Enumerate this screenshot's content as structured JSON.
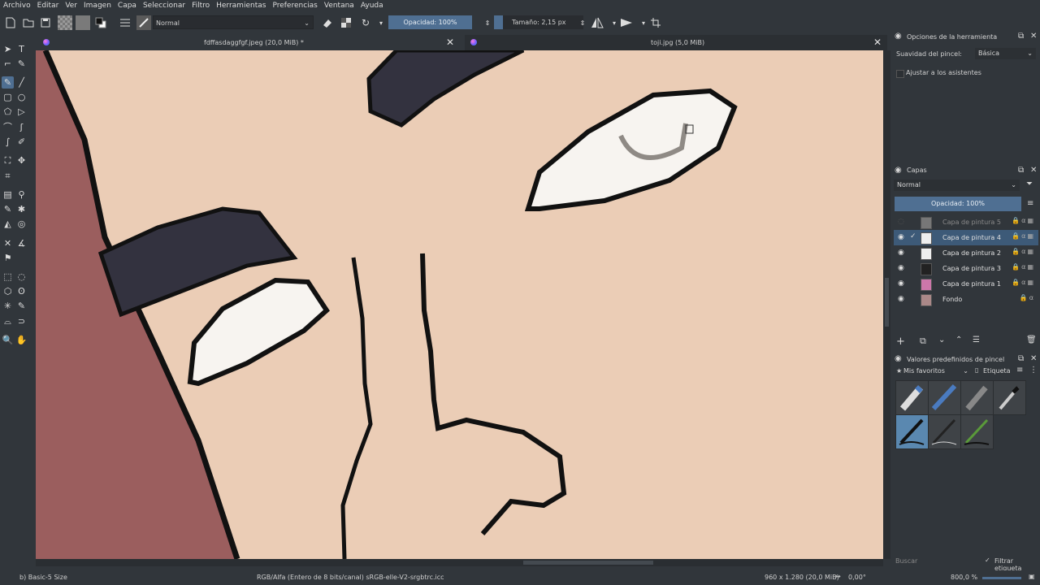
{
  "menu": [
    "Archivo",
    "Editar",
    "Ver",
    "Imagen",
    "Capa",
    "Seleccionar",
    "Filtro",
    "Herramientas",
    "Preferencias",
    "Ventana",
    "Ayuda"
  ],
  "toolbar": {
    "blend_mode": "Normal",
    "opacity_label": "Opacidad: 100%",
    "opacity_value": 1.0,
    "size_label": "Tamaño: 2,15 px",
    "size_fraction": 0.1
  },
  "tabs": [
    {
      "label": "fdffasdaggfgf.jpeg (20,0 MiB) *",
      "active": true
    },
    {
      "label": "toji.jpg (5,0 MiB)",
      "active": false
    }
  ],
  "tool_options": {
    "title": "Opciones de la herramienta",
    "smoothing_label": "Suavidad del pincel:",
    "smoothing_value": "Básica",
    "assistants_label": "Ajustar a los asistentes"
  },
  "layers_panel": {
    "title": "Capas",
    "blend_mode": "Normal",
    "opacity_label": "Opacidad:  100%",
    "layers": [
      {
        "name": "Capa de pintura 5",
        "visible": false,
        "active": false
      },
      {
        "name": "Capa de pintura 4",
        "visible": true,
        "active": true
      },
      {
        "name": "Capa de pintura 2",
        "visible": true,
        "active": false
      },
      {
        "name": "Capa de pintura 3",
        "visible": true,
        "active": false
      },
      {
        "name": "Capa de pintura 1",
        "visible": true,
        "active": false
      },
      {
        "name": "Fondo",
        "visible": true,
        "active": false
      }
    ]
  },
  "brush_presets": {
    "title": "Valores predefinidos de pincel",
    "favorites_label": "Mis favoritos",
    "tag_label": "Etiqueta",
    "search_placeholder": "Buscar",
    "filter_tag_label": "Filtrar etiqueta"
  },
  "status": {
    "brush": "b) Basic-5 Size",
    "color_space": "RGB/Alfa (Entero de 8 bits/canal)  sRGB-elle-V2-srgbtrc.icc",
    "dimensions": "960 x 1.280 (20,0 MiB)",
    "rotation": "0,00°",
    "zoom": "800,0 %"
  },
  "colors": {
    "accent": "#4f6f92",
    "skin": "#ebcdb6",
    "hair": "#33323f",
    "shadow": "#9b5e5e"
  }
}
